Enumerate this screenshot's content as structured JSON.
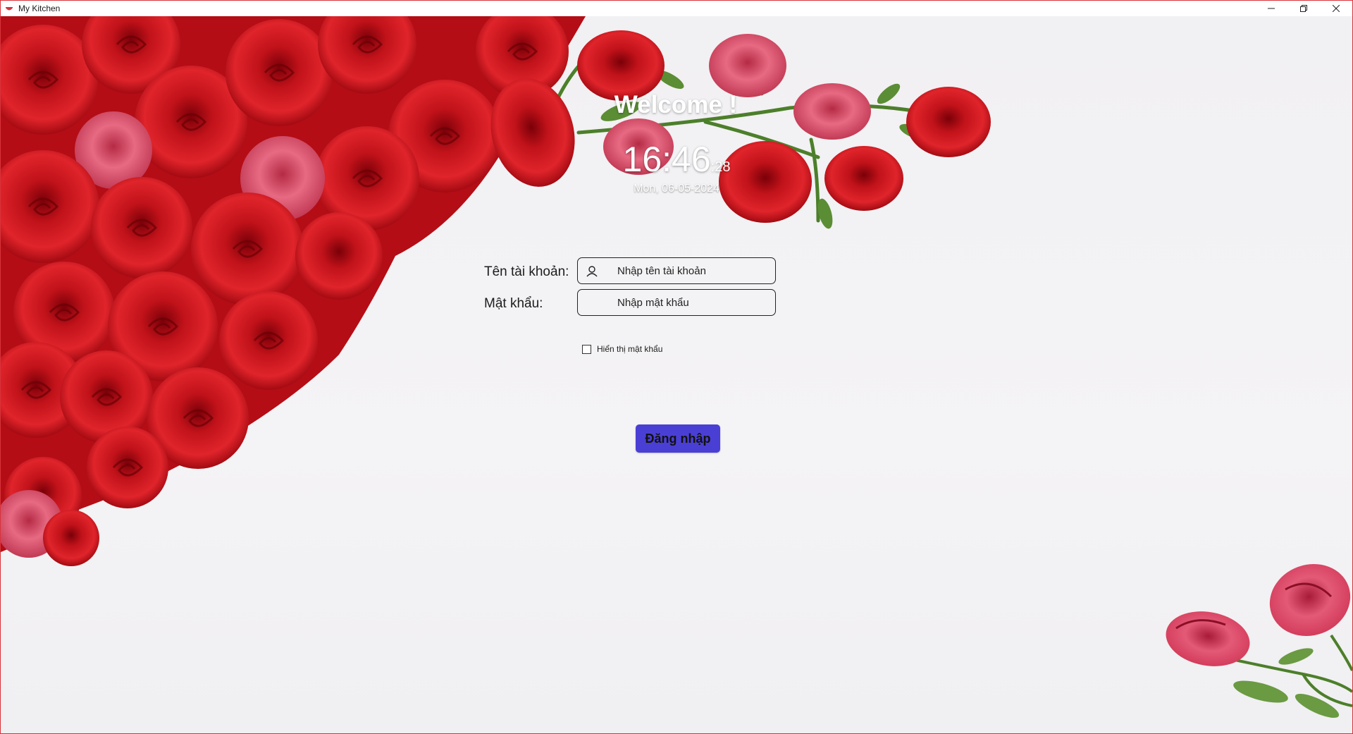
{
  "window": {
    "title": "My Kitchen",
    "accent_color": "#d8333a",
    "controls": [
      "minimize-icon",
      "restore-icon",
      "close-icon"
    ]
  },
  "header": {
    "welcome": "Welcome !",
    "time_hm": "16:46",
    "time_seconds": "28",
    "date": "Mon, 06-05-2024"
  },
  "form": {
    "username_label": "Tên tài khoản:",
    "username_placeholder": "Nhập tên tài khoản",
    "username_value": "",
    "password_label": "Mật khẩu:",
    "password_placeholder": "Nhập mật khẩu",
    "password_value": "",
    "show_password_label": "Hiển thị mật khẩu",
    "show_password_checked": false,
    "login_button": "Đăng nhập",
    "button_color": "#4a3fd4"
  }
}
